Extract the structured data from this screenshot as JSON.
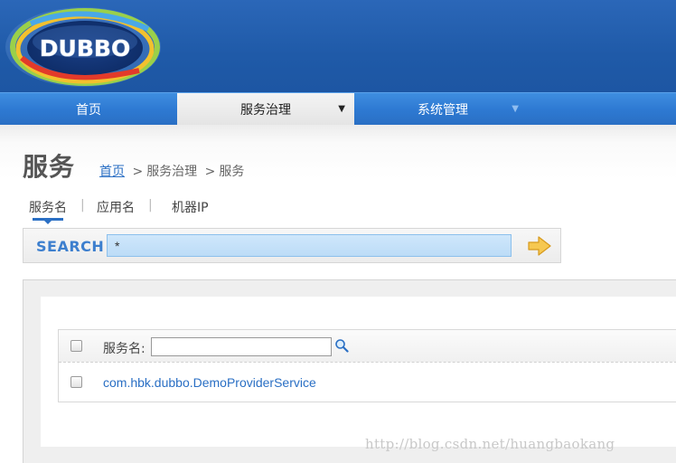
{
  "logo": {
    "text": "DUBBO"
  },
  "nav": {
    "home": "首页",
    "service": "服务治理",
    "system": "系统管理",
    "caret": "▼"
  },
  "page": {
    "title": "服务",
    "breadcrumb": {
      "home": "首页",
      "sep": ">",
      "level1": "服务治理",
      "level2": "服务"
    }
  },
  "tabs": {
    "service_name": "服务名",
    "app_name": "应用名",
    "machine_ip": "机器IP",
    "separator": "|"
  },
  "search": {
    "label": "SEARCH",
    "value": "*",
    "go_icon": "arrow-right-icon"
  },
  "table": {
    "header": {
      "column_label": "服务名:",
      "filter_value": "",
      "filter_icon": "magnifier-icon"
    },
    "rows": [
      {
        "service": "com.hbk.dubbo.DemoProviderService"
      }
    ]
  },
  "watermark": "http://blog.csdn.net/huangbaokang",
  "colors": {
    "header_blue": "#1f5aa8",
    "nav_blue": "#2e7ad3",
    "link_blue": "#2a6fc4",
    "search_input_bg": "#c4e0f8",
    "go_arrow": "#f2b53a"
  }
}
